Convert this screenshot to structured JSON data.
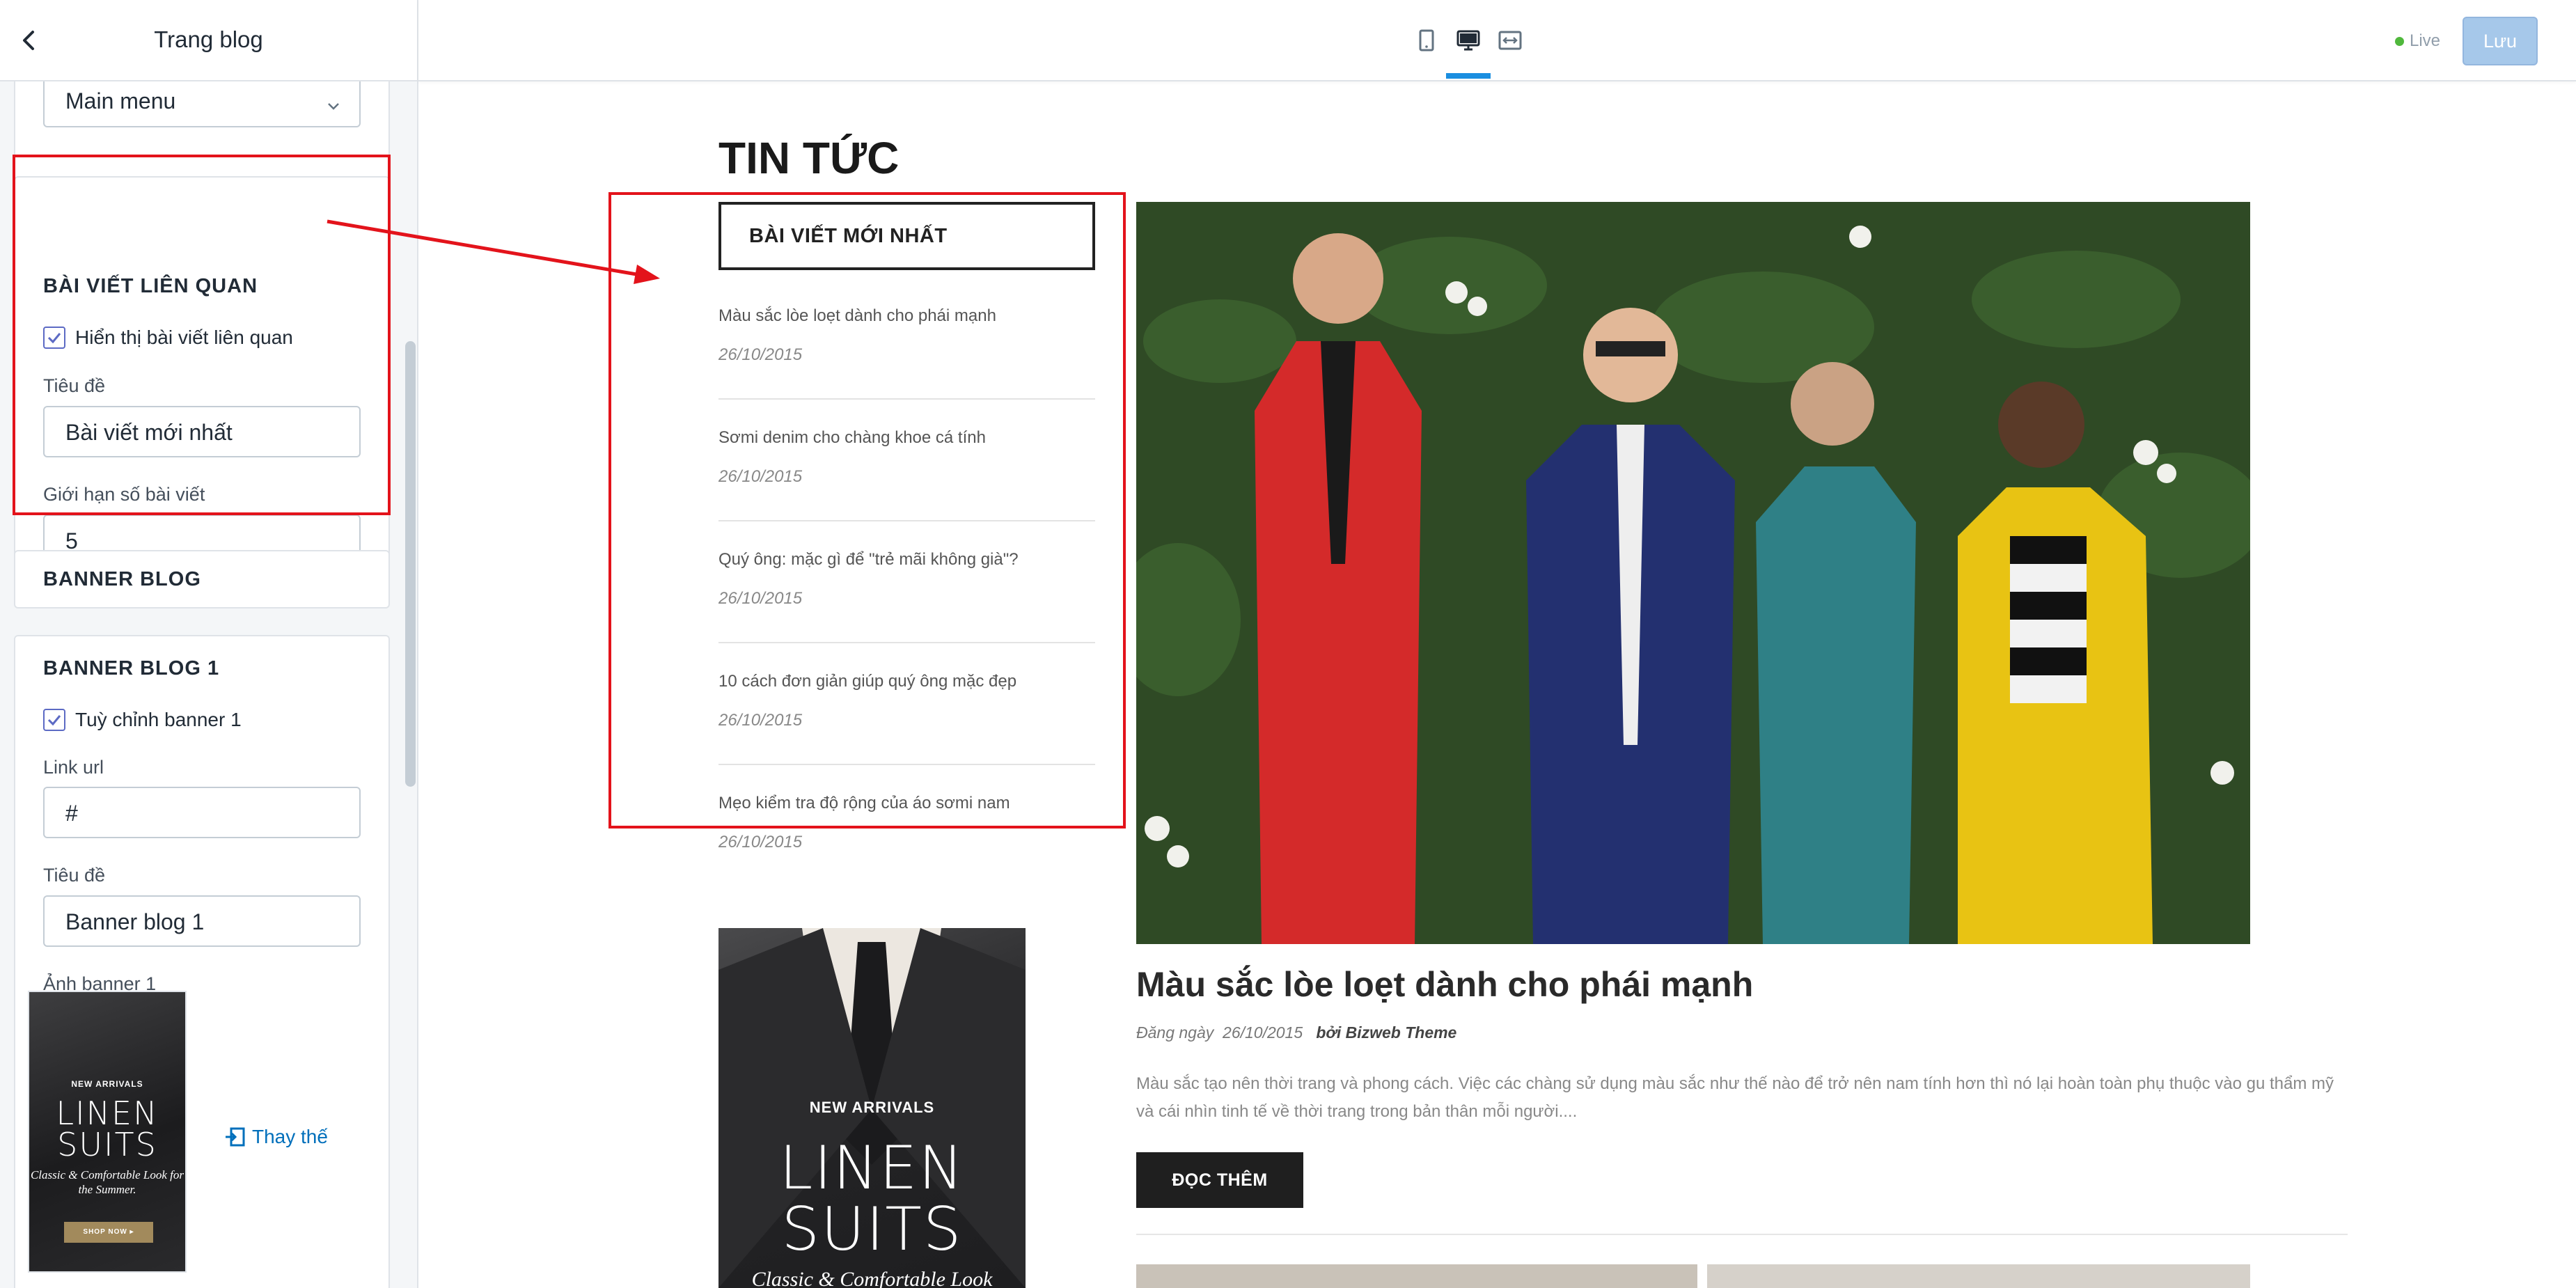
{
  "sidebar": {
    "title": "Trang blog",
    "menu_select_value": "Main menu",
    "related": {
      "heading": "BÀI VIẾT LIÊN QUAN",
      "show_label": "Hiển thị bài viết liên quan",
      "show_checked": true,
      "title_label": "Tiêu đề",
      "title_value": "Bài viết mới nhất",
      "limit_label": "Giới hạn số bài viết",
      "limit_value": "5"
    },
    "banner_blog_heading": "BANNER BLOG",
    "banner1": {
      "heading": "BANNER BLOG 1",
      "custom_label": "Tuỳ chỉnh banner 1",
      "custom_checked": true,
      "link_label": "Link url",
      "link_value": "#",
      "title_label": "Tiêu đề",
      "title_value": "Banner blog 1",
      "image_label": "Ảnh banner 1",
      "replace_label": "Thay thế"
    }
  },
  "topbar": {
    "devices": [
      "mobile-icon",
      "desktop-icon",
      "fullwidth-icon"
    ],
    "active_device": "desktop",
    "live_label": "Live",
    "save_label": "Lưu",
    "accent": "#1a8ee0"
  },
  "preview": {
    "heading": "TIN TỨC",
    "recent_title": "BÀI VIẾT MỚI NHẤT",
    "recent_posts": [
      {
        "title": "Màu sắc lòe loẹt dành cho phái mạnh",
        "date": "26/10/2015"
      },
      {
        "title": "Sơmi denim cho chàng khoe cá tính",
        "date": "26/10/2015"
      },
      {
        "title": "Quý ông: mặc gì để \"trẻ mãi không già\"?",
        "date": "26/10/2015"
      },
      {
        "title": "10 cách đơn giản giúp quý ông mặc đẹp",
        "date": "26/10/2015"
      },
      {
        "title": "Mẹo kiểm tra độ rộng của áo sơmi nam",
        "date": "26/10/2015"
      }
    ],
    "banner": {
      "small": "NEW ARRIVALS",
      "line1": "LINEN",
      "line2": "SUITS",
      "italic": "Classic & Comfortable Look",
      "thumb_italic": "Classic & Comfortable Look for the Summer.",
      "thumb_button": "SHOP NOW ▸"
    },
    "main_post": {
      "title": "Màu sắc lòe loẹt dành cho phái mạnh",
      "posted_prefix": "Đăng ngày",
      "date": "26/10/2015",
      "author": "bởi Bizweb Theme",
      "excerpt": "Màu sắc tạo nên thời trang và phong cách. Việc các chàng sử dụng màu sắc như thế nào để trở nên nam tính hơn thì nó lại hoàn toàn phụ thuộc vào gu thẩm mỹ và cái nhìn tinh tế về thời trang trong bản thân mỗi người....",
      "read_more": "ĐỌC THÊM"
    },
    "highlight_color": "#e3131b"
  }
}
